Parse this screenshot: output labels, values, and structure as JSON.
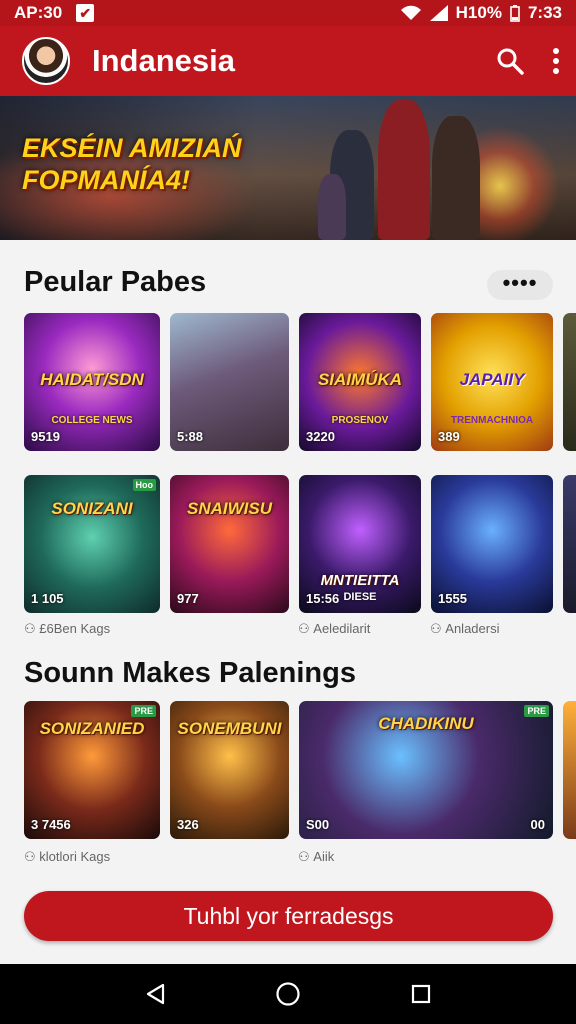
{
  "status_bar": {
    "time_left": "AP:30",
    "battery": "H10%",
    "clock": "7:33"
  },
  "app_bar": {
    "title": "Indanesia",
    "icons": [
      "search-icon",
      "more-vert-icon"
    ]
  },
  "hero": {
    "title_line1": "EKSÉIN AMIZIAŃ",
    "title_line2": "FOPMANÍA4!"
  },
  "section1": {
    "title": "Peular Pabes",
    "more_label": "••••",
    "row1": [
      {
        "title": "HAIDAT/SDN",
        "sub": "COLLEGE NEWS",
        "count": "9519"
      },
      {
        "title": "",
        "sub": "",
        "count": "5:88"
      },
      {
        "title": "SIAIMÚKA",
        "sub": "PROSENOV",
        "count": "3220"
      },
      {
        "title": "JAPAIIY",
        "sub": "TRENMACHNIOA",
        "count": "389"
      }
    ],
    "row2": [
      {
        "title": "SONIZANI",
        "sub": "",
        "count": "1 105",
        "badge": "Hoo"
      },
      {
        "title": "SNAIWISU",
        "sub": "",
        "count": "977"
      },
      {
        "title": "MNTIEITTA",
        "sub": "DIESE",
        "count": "15:56"
      },
      {
        "title": "",
        "sub": "",
        "count": "1555"
      }
    ],
    "row2_meta": [
      "£6Ben Kags",
      "Aeledilarit",
      "Anladersi"
    ]
  },
  "section2": {
    "title": "Sounn Makes Palenings",
    "row": [
      {
        "title": "SONIZANIED",
        "sub": "",
        "count": "3 7456",
        "badge": "PRE"
      },
      {
        "title": "SONEMBUNI",
        "sub": "",
        "count": "326"
      },
      {
        "title": "CHADIKINU",
        "sub": "",
        "count": "S00",
        "count_right": "00",
        "badge": "PRE"
      }
    ],
    "row_meta": [
      "klotlori Kags",
      "Aiik"
    ]
  },
  "cta_label": "Tuhbl yor ferradesgs",
  "nav_icons": [
    "back-icon",
    "home-icon",
    "recents-icon"
  ]
}
